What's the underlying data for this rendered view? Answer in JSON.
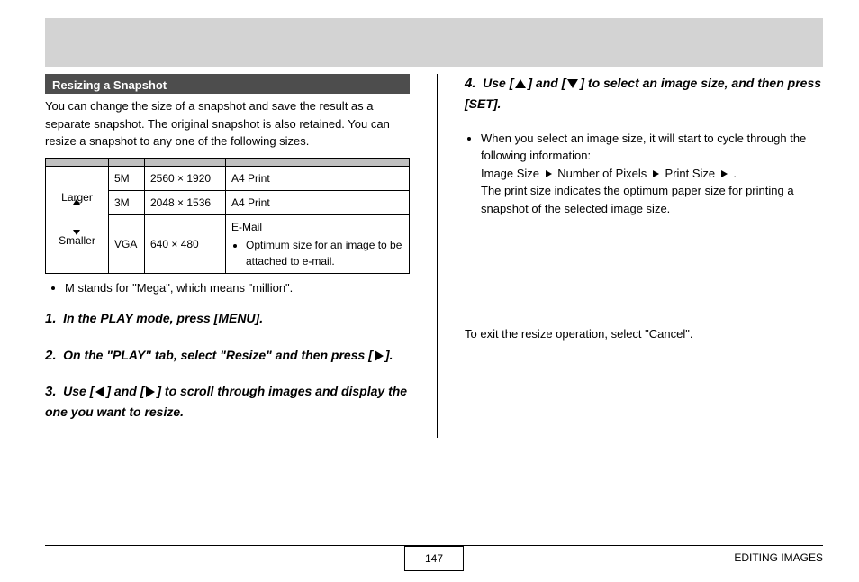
{
  "header_title": "",
  "section_title": "Resizing a Snapshot",
  "intro": "You can change the size of a snapshot and save the result as a separate snapshot. The original snapshot is also retained. You can resize a snapshot to any one of the following sizes.",
  "table": {
    "arrow_top": "Larger",
    "arrow_bottom": "Smaller",
    "rows": [
      {
        "size": "5M",
        "pixels": "2560 × 1920",
        "desc": "A4 Print"
      },
      {
        "size": "3M",
        "pixels": "2048 × 1536",
        "desc": "A4 Print"
      },
      {
        "size": "VGA",
        "pixels": "640 × 480",
        "desc": "E-Mail",
        "sub": "Optimum size for an image to be attached to e-mail."
      }
    ]
  },
  "mega_note": "M stands for \"Mega\", which means \"million\".",
  "steps_left": [
    {
      "n": "1.",
      "t": "In the PLAY mode, press [MENU]."
    },
    {
      "n": "2.",
      "t_before": "On the \"PLAY\" tab, select \"Resize\" and then press [",
      "t_after": "]."
    },
    {
      "n": "3.",
      "t_before": "Use [",
      "t_mid": "] and [",
      "t_after": "] to scroll through images and display the one you want to resize."
    }
  ],
  "steps_right": [
    {
      "n": "4.",
      "t_before": "Use [",
      "t_mid": "] and [",
      "t_after": "] to select an image size, and then press [SET]."
    }
  ],
  "right_bullets": {
    "lead": "When you select an image size, it will start to cycle through the following information:",
    "seq_a": "Image Size",
    "seq_b": "Number of Pixels",
    "seq_c": "Print Size",
    "tail": "The print size indicates the optimum paper size for printing a snapshot of the selected image size."
  },
  "cancel_note": "To exit the resize operation, select \"Cancel\".",
  "footer_label": "EDITING IMAGES",
  "page_number": "147"
}
